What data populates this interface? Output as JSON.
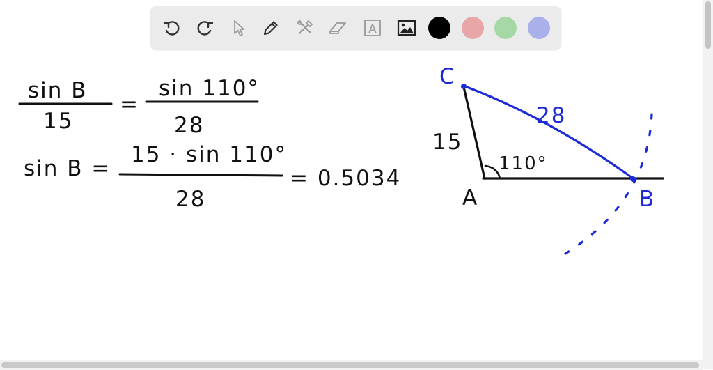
{
  "toolbar": {
    "tools": [
      {
        "name": "undo-icon",
        "label": "Undo"
      },
      {
        "name": "redo-icon",
        "label": "Redo"
      },
      {
        "name": "select-icon",
        "label": "Select"
      },
      {
        "name": "pen-icon",
        "label": "Pen"
      },
      {
        "name": "tools-icon",
        "label": "Tools"
      },
      {
        "name": "eraser-icon",
        "label": "Eraser"
      },
      {
        "name": "text-icon",
        "label": "Text",
        "glyph": "A"
      },
      {
        "name": "image-icon",
        "label": "Image"
      }
    ],
    "colors": [
      "#000000",
      "#e9a6a8",
      "#a6d8a6",
      "#aab0ea"
    ],
    "selected_color": "#000000"
  },
  "canvas": {
    "ink_colors": {
      "black": "#111111",
      "blue": "#1d2bd6"
    },
    "equation1": {
      "left_num": "sin B",
      "left_den": "15",
      "equals": "=",
      "right_num": "sin 110°",
      "right_den": "28"
    },
    "equation2": {
      "lhs": "sin B =",
      "num": "15 · sin 110°",
      "den": "28",
      "result": "= 0.5034"
    },
    "triangle": {
      "vertex_c": "C",
      "vertex_a": "A",
      "vertex_b": "B",
      "side_ac": "15",
      "side_cb": "28",
      "angle_a": "110°"
    }
  }
}
